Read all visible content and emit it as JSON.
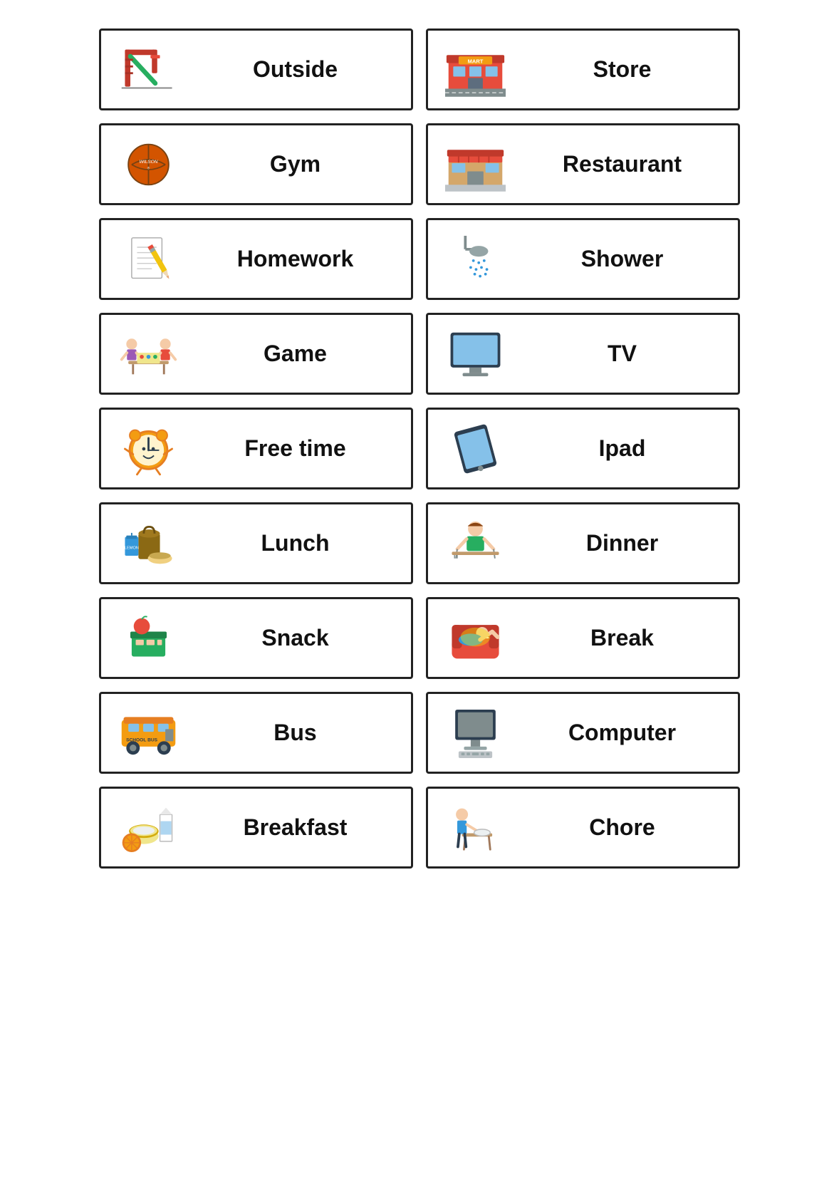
{
  "cards": [
    {
      "id": "outside",
      "label": "Outside",
      "icon": "outside"
    },
    {
      "id": "store",
      "label": "Store",
      "icon": "store"
    },
    {
      "id": "gym",
      "label": "Gym",
      "icon": "gym"
    },
    {
      "id": "restaurant",
      "label": "Restaurant",
      "icon": "restaurant"
    },
    {
      "id": "homework",
      "label": "Homework",
      "icon": "homework"
    },
    {
      "id": "shower",
      "label": "Shower",
      "icon": "shower"
    },
    {
      "id": "game",
      "label": "Game",
      "icon": "game"
    },
    {
      "id": "tv",
      "label": "TV",
      "icon": "tv"
    },
    {
      "id": "freetime",
      "label": "Free time",
      "icon": "freetime"
    },
    {
      "id": "ipad",
      "label": "Ipad",
      "icon": "ipad"
    },
    {
      "id": "lunch",
      "label": "Lunch",
      "icon": "lunch"
    },
    {
      "id": "dinner",
      "label": "Dinner",
      "icon": "dinner"
    },
    {
      "id": "snack",
      "label": "Snack",
      "icon": "snack"
    },
    {
      "id": "break",
      "label": "Break",
      "icon": "break"
    },
    {
      "id": "bus",
      "label": "Bus",
      "icon": "bus"
    },
    {
      "id": "computer",
      "label": "Computer",
      "icon": "computer"
    },
    {
      "id": "breakfast",
      "label": "Breakfast",
      "icon": "breakfast"
    },
    {
      "id": "chore",
      "label": "Chore",
      "icon": "chore"
    }
  ]
}
